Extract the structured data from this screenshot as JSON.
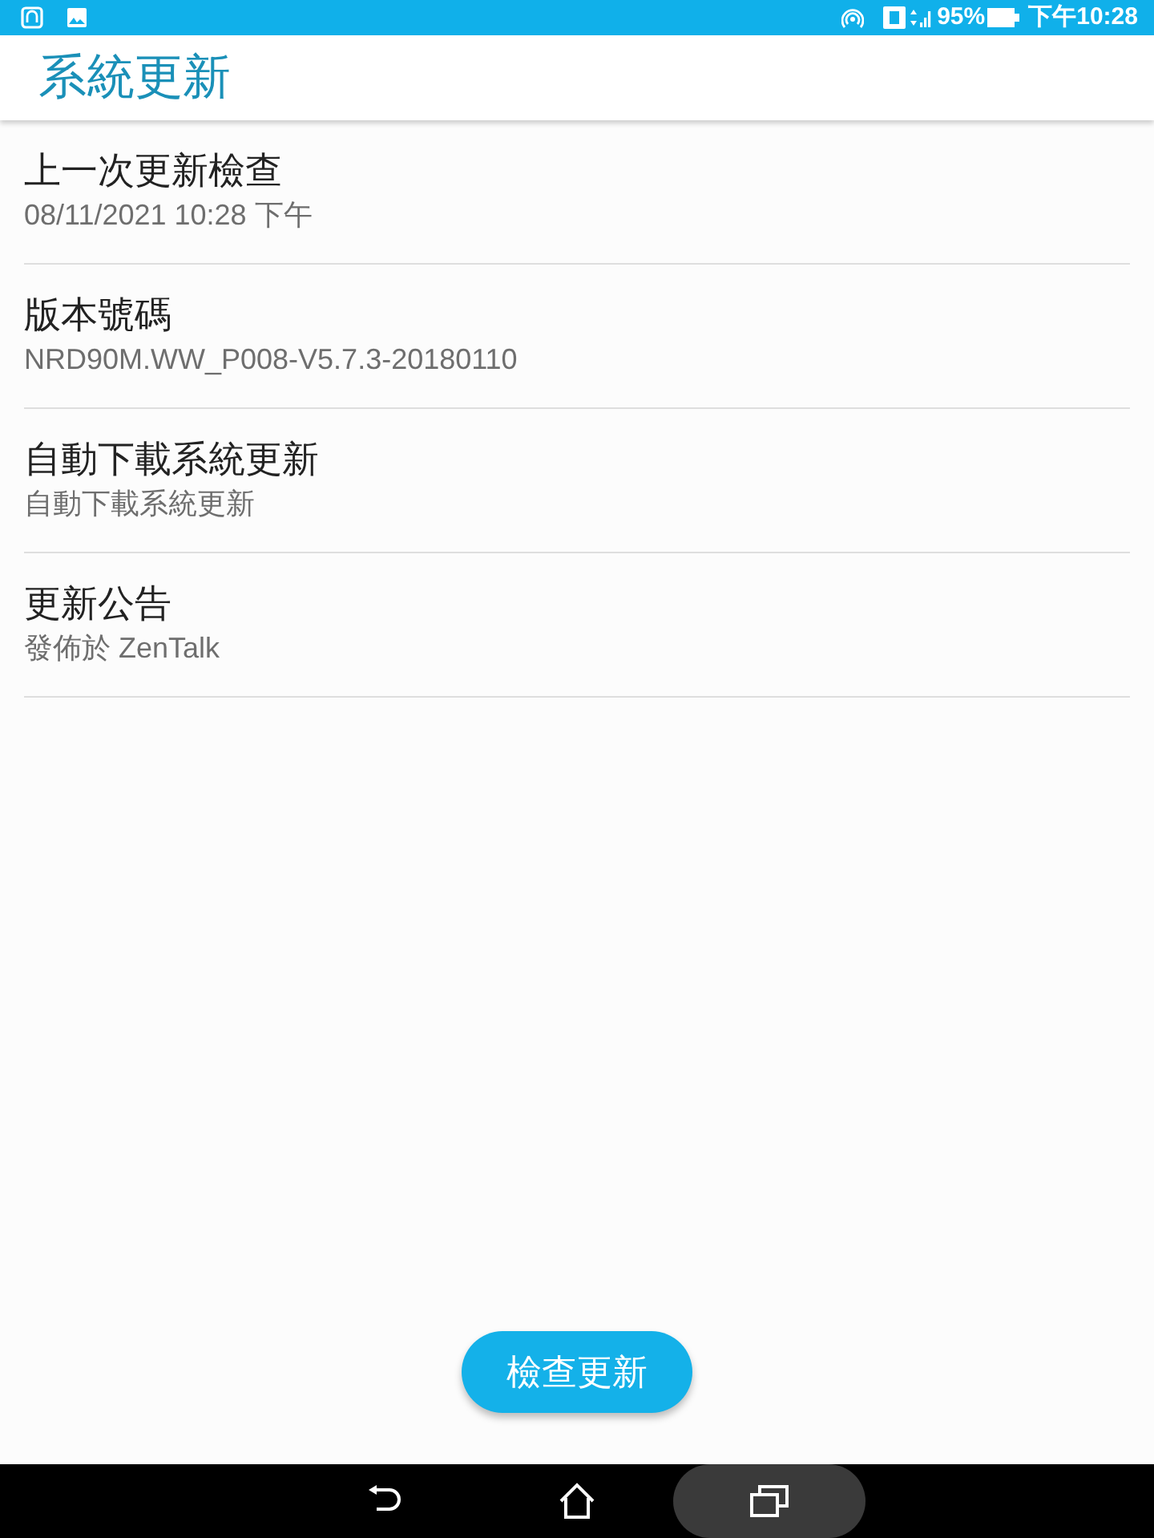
{
  "status_bar": {
    "battery": "95%",
    "time": "下午10:28"
  },
  "title": "系統更新",
  "items": [
    {
      "title": "上一次更新檢查",
      "subtitle": "08/11/2021 10:28 下午"
    },
    {
      "title": "版本號碼",
      "subtitle": "NRD90M.WW_P008-V5.7.3-20180110"
    },
    {
      "title": "自動下載系統更新",
      "subtitle": "自動下載系統更新"
    },
    {
      "title": "更新公告",
      "subtitle": "發佈於 ZenTalk"
    }
  ],
  "check_button": "檢查更新",
  "nav_bar": [
    {
      "kind": "back",
      "selected": false
    },
    {
      "kind": "home",
      "selected": false
    },
    {
      "kind": "recents",
      "selected": true
    }
  ]
}
